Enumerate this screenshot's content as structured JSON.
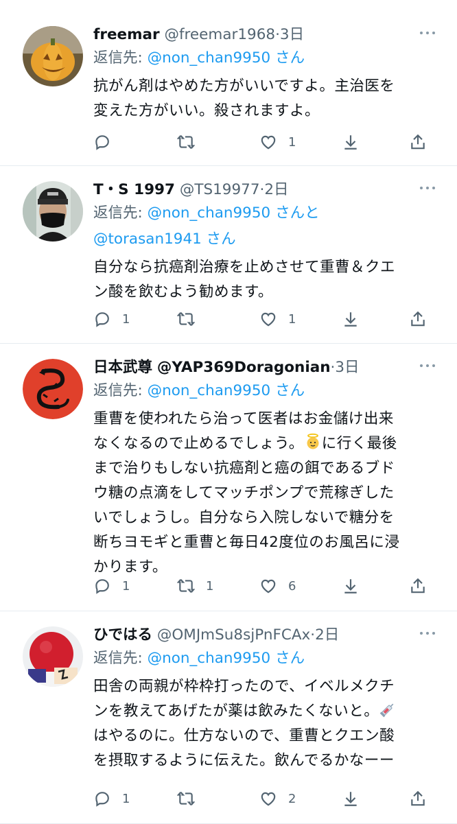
{
  "tweets": [
    {
      "name": "freemar",
      "handle": "@freemar1968",
      "dot": "·",
      "time": "3日",
      "reply_prefix": "返信先: ",
      "reply_mention": "@non_chan9950",
      "reply_suffix": "さん",
      "body_lines": [
        "抗がん剤はやめた方がいいですよ。主治医を",
        "変えた方がいい。殺されますよ。"
      ],
      "replies": "",
      "retweets": "",
      "likes": "1",
      "avatar": "pumpkin-avatar"
    },
    {
      "name": "T・S 1997",
      "handle": "@TS19977",
      "dot": "·",
      "time": "2日",
      "reply_prefix": "返信先: ",
      "reply_mention": "@non_chan9950",
      "reply_suffix": "さんと",
      "reply_line2_mention": "@torasan1941",
      "reply_line2_suffix": "さん",
      "body_lines": [
        "自分なら抗癌剤治療を止めさせて重曹＆クエ",
        "ン酸を飲むよう勧めます。"
      ],
      "replies": "1",
      "retweets": "",
      "likes": "1",
      "avatar": "masked-person-avatar"
    },
    {
      "name": "日本武尊",
      "handle": "@YAP369Doragonian",
      "dot": "·",
      "time": "3日",
      "reply_prefix": "返信先: ",
      "reply_mention": "@non_chan9950",
      "reply_suffix": "さん",
      "body_lines": [
        "重曹を使われたら治って医者はお金儲け出来",
        "なくなるので止めるでしょう。",
        "に行く最後",
        "まで治りもしない抗癌剤と癌の餌であるブド",
        "ウ糖の点滴をしてマッチポンプで荒稼ぎした",
        "いでしょうし。自分なら入院しないで糖分を",
        "断ちヨモギと重曹と毎日42度位のお風呂に浸",
        "かります。"
      ],
      "replies": "1",
      "retweets": "1",
      "likes": "6",
      "avatar": "dragon-avatar"
    },
    {
      "name": "ひではる",
      "handle": "@OMJmSu8sjPnFCAx",
      "dot": "·",
      "time": "2日",
      "reply_prefix": "返信先: ",
      "reply_mention": "@non_chan9950",
      "reply_suffix": "さん",
      "body_lines": [
        "田舎の両親が枠枠打ったので、イベルメクチ",
        "ンを教えてあげたが薬は飲みたくないと。",
        "はやるのに。仕方ないので、重曹とクエン酸",
        "を摂取するように伝えた。飲んでるかなーー"
      ],
      "replies": "1",
      "retweets": "",
      "likes": "2",
      "avatar": "red-ball-avatar"
    }
  ],
  "colors": {
    "mention": "#1d9bf0",
    "secondary": "#536471",
    "divider": "#e6ecf0"
  }
}
